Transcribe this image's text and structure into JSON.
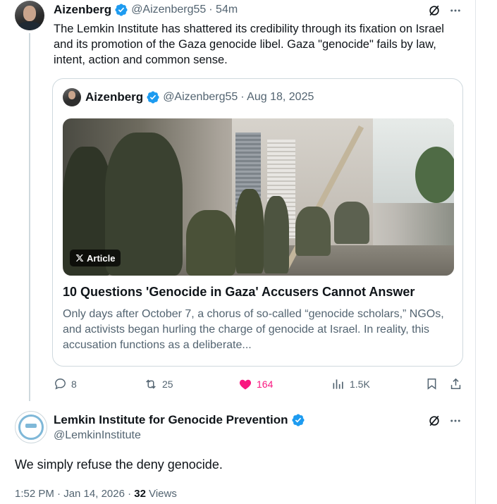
{
  "tweet": {
    "author_name": "Aizenberg",
    "author_handle": "@Aizenberg55",
    "time_ago": "· 54m",
    "text": "The Lemkin Institute has shattered its credibility through its fixation on Israel and its promotion of the Gaza genocide libel. Gaza \"genocide\" fails by law, intent, action and common sense.",
    "quote": {
      "author_name": "Aizenberg",
      "author_handle": "@Aizenberg55",
      "date": "· Aug 18, 2025",
      "badge_label": "Article",
      "title": "10 Questions 'Genocide in Gaza' Accusers Cannot Answer",
      "description": "Only days after October 7, a chorus of so-called “genocide scholars,” NGOs, and activists began hurling the charge of genocide at Israel. In reality, this accusation functions as a deliberate..."
    },
    "actions": {
      "replies": "8",
      "reposts": "25",
      "likes": "164",
      "views": "1.5K"
    }
  },
  "reply": {
    "author_name": "Lemkin Institute for Genocide Prevention",
    "author_handle": "@LemkinInstitute",
    "text": "We simply refuse the deny genocide.",
    "meta_time": "1:52 PM · Jan 14, 2026 · ",
    "views_count": "32",
    "views_label": " Views"
  },
  "colors": {
    "verified": "#1d9bf0",
    "like": "#f91880",
    "secondary_text": "#536471",
    "border": "#cfd9de"
  },
  "icons": [
    "verified-badge-icon",
    "grok-icon",
    "more-icon",
    "x-logo-icon",
    "reply-icon",
    "repost-icon",
    "heart-icon",
    "views-icon",
    "bookmark-icon",
    "share-icon"
  ]
}
